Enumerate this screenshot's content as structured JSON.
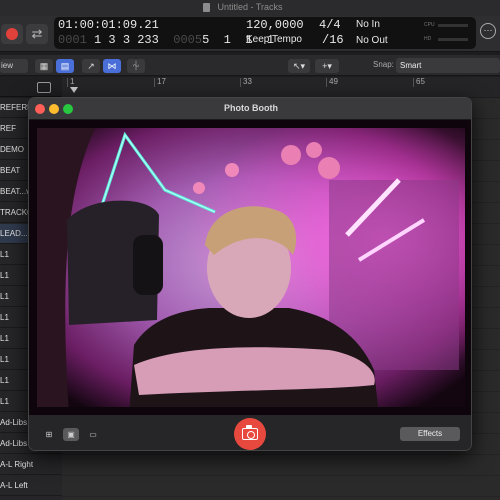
{
  "window": {
    "title": "Untitled - Tracks"
  },
  "control_bar": {
    "lcd": {
      "time_position": "01:00:01:09.21",
      "bar_position": {
        "bar": "1",
        "beat": "3",
        "division": "3",
        "ticks": "233"
      },
      "bar_position_dim": "0001",
      "end_position_dim": "0005",
      "end_position": "5  1  1  1",
      "time_dim_prefix": "0001",
      "tempo": "120,0000",
      "tempo_mode": "Keep Tempo",
      "time_signature": "4/4",
      "division": "/16",
      "midi_in": "No In",
      "midi_out": "No Out",
      "cpu_label": "CPU",
      "hd_label": "HD"
    }
  },
  "tracks_toolbar": {
    "view_label": "iew",
    "snap_label": "Snap:",
    "snap_value": "Smart"
  },
  "ruler": {
    "marks": [
      "1",
      "17",
      "33",
      "49",
      "65"
    ]
  },
  "tracks": [
    "REFERE",
    "REF",
    "DEMO",
    "BEAT",
    "BEAT...v",
    "TRACK0",
    "LEAD...0",
    "L1",
    "L1",
    "L1",
    "L1",
    "L1",
    "L1",
    "L1",
    "L1",
    "Ad-Libs",
    "Ad-Libs",
    "A-L Right",
    "A-L Left"
  ],
  "photo_booth": {
    "title": "Photo Booth",
    "effects_label": "Effects",
    "accent_color": "#e8493f"
  },
  "icons": {
    "record": "record-icon",
    "cycle": "cycle-icon",
    "settings": "settings-icon",
    "camera": "camera-icon",
    "grid_view": "grid-view-icon",
    "single_view": "single-photo-icon",
    "video": "video-camera-icon"
  }
}
